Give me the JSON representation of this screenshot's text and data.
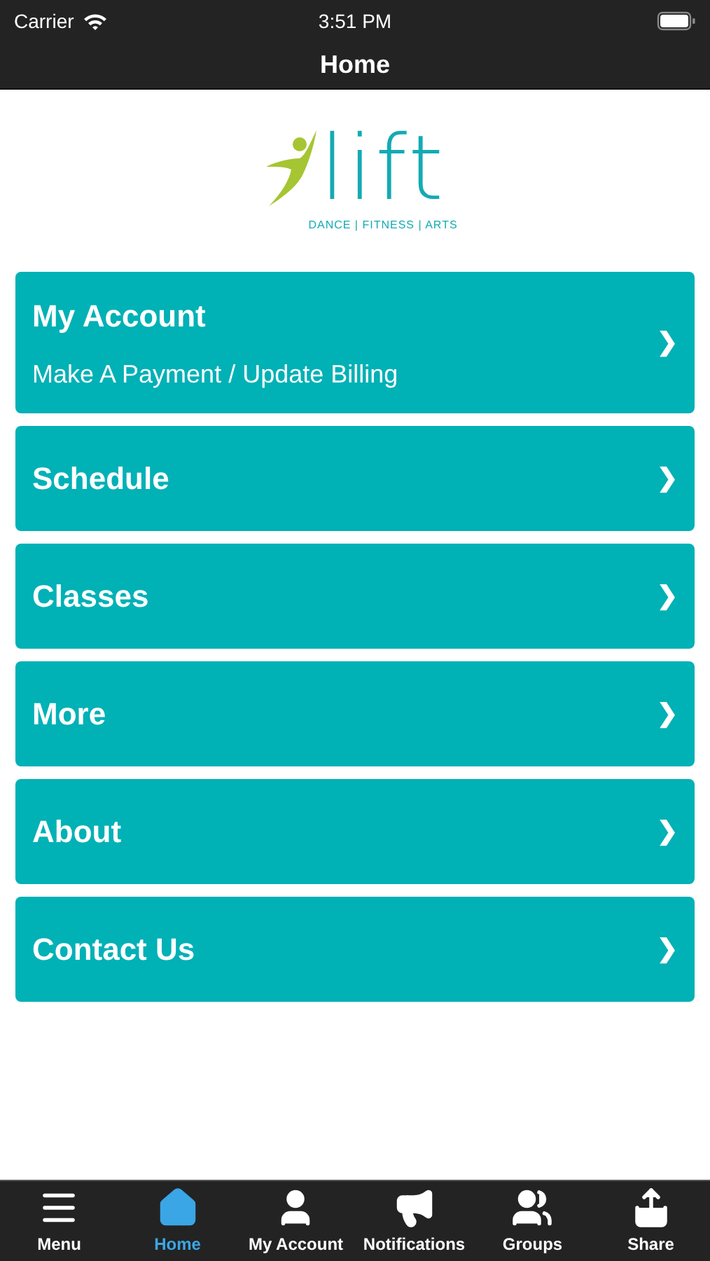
{
  "status_bar": {
    "carrier": "Carrier",
    "time": "3:51 PM"
  },
  "nav_bar": {
    "title": "Home"
  },
  "logo": {
    "wordmark": "lift",
    "tagline": "DANCE | FITNESS | ARTS"
  },
  "menu_items": [
    {
      "title": "My Account",
      "subtitle": "Make A Payment / Update Billing",
      "chevron": "❯"
    },
    {
      "title": "Schedule",
      "chevron": "❯"
    },
    {
      "title": "Classes",
      "chevron": "❯"
    },
    {
      "title": "More",
      "chevron": "❯"
    },
    {
      "title": "About",
      "chevron": "❯"
    },
    {
      "title": "Contact Us",
      "chevron": "❯"
    }
  ],
  "tab_bar": [
    {
      "kind": "menu",
      "label": "Menu",
      "selected": false
    },
    {
      "kind": "home",
      "label": "Home",
      "selected": true
    },
    {
      "kind": "account",
      "label": "My Account",
      "selected": false
    },
    {
      "kind": "notifications",
      "label": "Notifications",
      "selected": false
    },
    {
      "kind": "groups",
      "label": "Groups",
      "selected": false
    },
    {
      "kind": "share",
      "label": "Share",
      "selected": false
    }
  ]
}
